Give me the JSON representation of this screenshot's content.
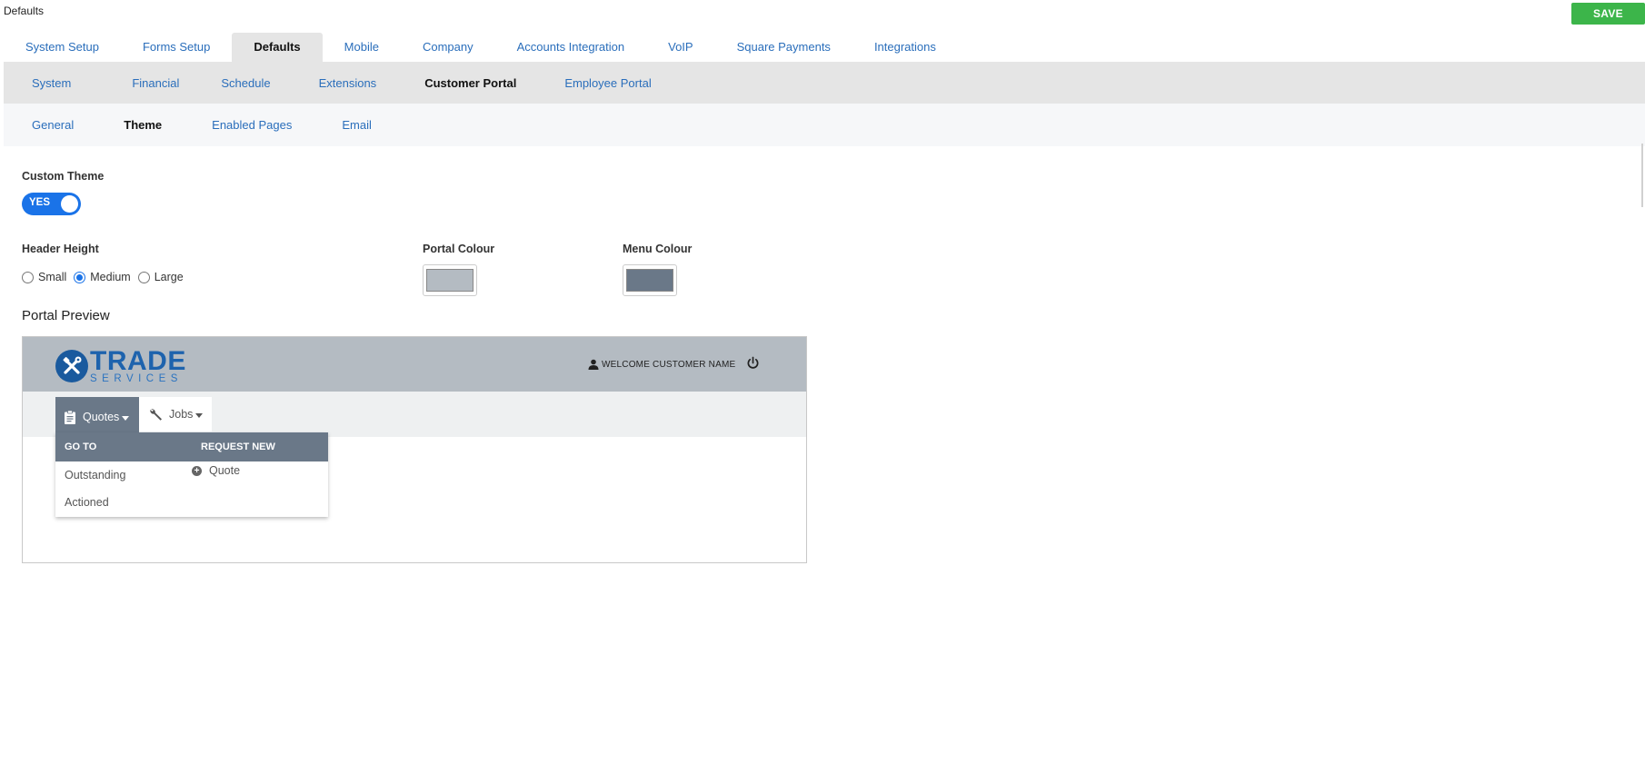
{
  "page": {
    "title": "Defaults",
    "save_label": "SAVE"
  },
  "main_tabs": [
    {
      "label": "System Setup"
    },
    {
      "label": "Forms Setup"
    },
    {
      "label": "Defaults",
      "active": true
    },
    {
      "label": "Mobile"
    },
    {
      "label": "Company"
    },
    {
      "label": "Accounts Integration"
    },
    {
      "label": "VoIP"
    },
    {
      "label": "Square Payments"
    },
    {
      "label": "Integrations"
    }
  ],
  "sub_tabs": [
    {
      "label": "System"
    },
    {
      "label": "Financial"
    },
    {
      "label": "Schedule"
    },
    {
      "label": "Extensions"
    },
    {
      "label": "Customer Portal",
      "active": true
    },
    {
      "label": "Employee Portal"
    }
  ],
  "portal_tabs": [
    {
      "label": "General"
    },
    {
      "label": "Theme",
      "active": true
    },
    {
      "label": "Enabled Pages"
    },
    {
      "label": "Email"
    }
  ],
  "custom_theme": {
    "label": "Custom Theme",
    "toggle_label": "YES",
    "enabled": true
  },
  "header_height": {
    "label": "Header Height",
    "options": [
      "Small",
      "Medium",
      "Large"
    ],
    "selected": "Medium"
  },
  "portal_colour": {
    "label": "Portal Colour",
    "value": "#b4bbc2"
  },
  "menu_colour": {
    "label": "Menu Colour",
    "value": "#6a7888"
  },
  "preview": {
    "title": "Portal Preview",
    "logo_main": "TRADE",
    "logo_sub": "SERVICES",
    "welcome": "WELCOME CUSTOMER NAME",
    "menu": [
      {
        "label": "Quotes",
        "icon": "clipboard-icon",
        "active": true
      },
      {
        "label": "Jobs",
        "icon": "wrench-icon"
      }
    ],
    "dropdown": {
      "goto_header": "GO TO",
      "request_header": "REQUEST NEW",
      "goto_items": [
        "Outstanding",
        "Actioned"
      ],
      "request_items": [
        "Quote"
      ]
    }
  }
}
